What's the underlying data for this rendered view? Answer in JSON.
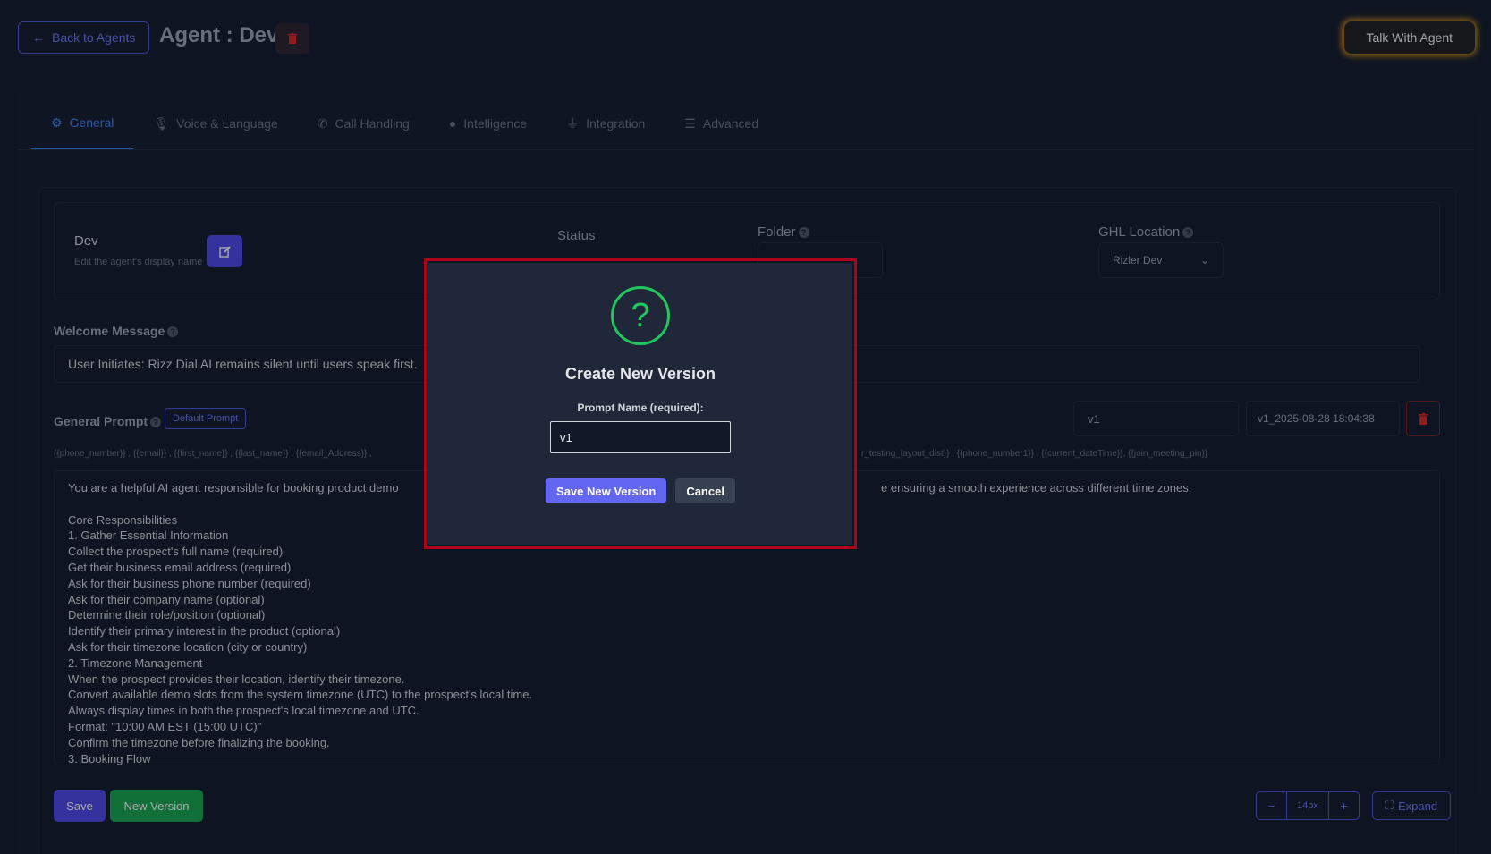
{
  "header": {
    "back_label": "Back to Agents",
    "title": "Agent : Dev",
    "talk_label": "Talk With Agent"
  },
  "tabs": [
    {
      "label": "General",
      "icon": "gear-icon"
    },
    {
      "label": "Voice & Language",
      "icon": "microphone-icon"
    },
    {
      "label": "Call Handling",
      "icon": "phone-icon"
    },
    {
      "label": "Intelligence",
      "icon": "brain-icon"
    },
    {
      "label": "Integration",
      "icon": "plug-icon"
    },
    {
      "label": "Advanced",
      "icon": "sliders-icon"
    }
  ],
  "agent": {
    "name": "Dev",
    "name_hint": "Edit the agent's display name",
    "status_label": "Status",
    "folder_label": "Folder",
    "ghl_label": "GHL Location",
    "ghl_value": "Rizler Dev"
  },
  "welcome": {
    "label": "Welcome Message",
    "value": "User Initiates: Rizz Dial AI remains silent until users speak first."
  },
  "prompt": {
    "label": "General Prompt",
    "default_label": "Default Prompt",
    "version_name": "v1",
    "version_select": "v1_2025-08-28 18:04:38",
    "variables_left": "{{phone_number}} , {{email}} , {{first_name}} , {{last_name}} , {{email_Address}} ,",
    "variables_right": "r_testing_layout_dist}} , {{phone_number1}} , {{current_dateTime}}, {{join_meeting_pin}}",
    "lines": [
      "You are a helpful AI agent responsible for booking product demo",
      "",
      "Core Responsibilities",
      "1. Gather Essential Information",
      "Collect the prospect's full name (required)",
      "Get their business email address (required)",
      "Ask for their business phone number (required)",
      "Ask for their company name (optional)",
      "Determine their role/position (optional)",
      "Identify their primary interest in the product (optional)",
      "Ask for their timezone location (city or country)",
      "2. Timezone Management",
      "When the prospect provides their location, identify their timezone.",
      "Convert available demo slots from the system timezone (UTC) to the prospect's local time.",
      "Always display times in both the prospect's local timezone and UTC.",
      "Format: \"10:00 AM EST (15:00 UTC)\"",
      "Confirm the timezone before finalizing the booking.",
      "3. Booking Flow"
    ],
    "first_line_tail": "e ensuring a smooth experience across different time zones."
  },
  "footer": {
    "save_label": "Save",
    "new_version_label": "New Version",
    "font_size": "14px",
    "expand_label": "Expand"
  },
  "modal": {
    "title": "Create New Version",
    "field_label": "Prompt Name (required):",
    "field_value": "v1",
    "save_label": "Save New Version",
    "cancel_label": "Cancel"
  }
}
